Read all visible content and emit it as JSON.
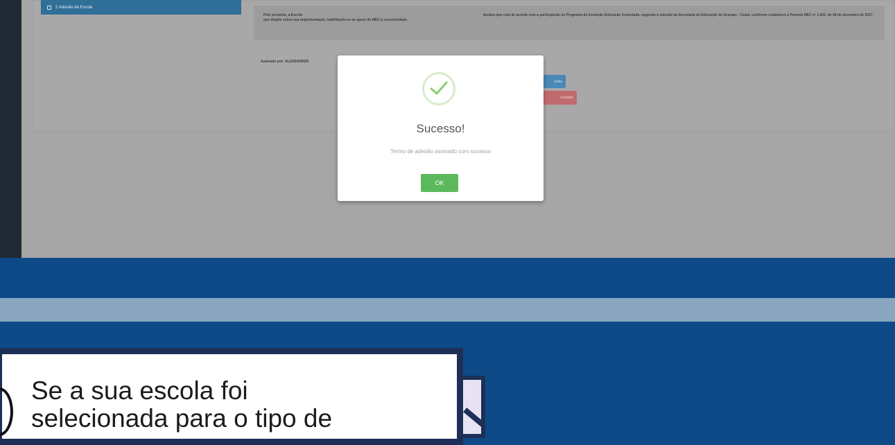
{
  "sidebar": {
    "active_item": "2.Adesão da Escola"
  },
  "term": {
    "text_start": "Pelo presente, a Escola",
    "text_rest": "declara que está de acordo com a participação no Programa de Inovação Educação Conectada, segundo a seleção da Secretaria de Educação de Acarape - Ceará, conforme estabelece a Portaria MEC nº 1.602, de 28 de dezembro de 2017, que dispõe sobre sua implementação, habilitando-se ao apoio do MEC à conectividade.",
    "signed_by": "Assinado por: ALEXSANDER"
  },
  "buttons": {
    "primary_fragment": "scola",
    "danger_fragment": "rescisão"
  },
  "modal": {
    "title": "Sucesso!",
    "message": "Termo de adesão assinado com sucesso",
    "ok_label": "OK"
  },
  "caption": {
    "line1": "Se a sua escola foi",
    "line2": "selecionada para o tipo de"
  },
  "colors": {
    "success": "#5cb85c",
    "navy": "#0d4a87",
    "light_band": "#8aa6bf"
  }
}
